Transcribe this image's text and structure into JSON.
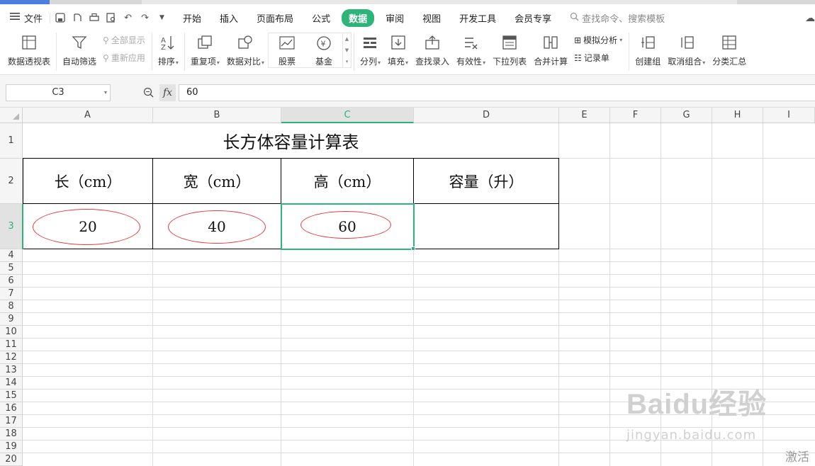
{
  "colors": {
    "accent": "#2eb37a",
    "oval": "#e53b3b",
    "tab_strip": [
      "#4a7fe0",
      "#e8e8e8"
    ]
  },
  "menubar": {
    "file_label": "文件",
    "tabs": [
      "开始",
      "插入",
      "页面布局",
      "公式",
      "数据",
      "审阅",
      "视图",
      "开发工具",
      "会员专享"
    ],
    "active_tab": "数据",
    "search_placeholder": "查找命令、搜索模板"
  },
  "ribbon": {
    "pivot": "数据透视表",
    "autofilter": "自动筛选",
    "show_all": "全部显示",
    "reapply": "重新应用",
    "sort": "排序",
    "duplicates": "重复项",
    "compare": "数据对比",
    "stock": "股票",
    "fund": "基金",
    "split": "分列",
    "fill": "填充",
    "lookup": "查找录入",
    "validity": "有效性",
    "dropdown": "下拉列表",
    "consolidate": "合并计算",
    "simulate": "模拟分析",
    "record": "记录单",
    "group": "创建组",
    "ungroup": "取消组合",
    "subtotal": "分类汇总"
  },
  "formula_bar": {
    "cell_ref": "C3",
    "fx": "fx",
    "value": "60"
  },
  "columns": [
    "A",
    "B",
    "C",
    "D",
    "E",
    "F",
    "G",
    "H",
    "I"
  ],
  "selected_column": "C",
  "rows": [
    "1",
    "2",
    "3",
    "4",
    "5",
    "6",
    "7",
    "8",
    "9",
    "10",
    "11",
    "12",
    "13",
    "14",
    "15",
    "16",
    "17",
    "18",
    "19",
    "20"
  ],
  "selected_row": "3",
  "sheet": {
    "title": "长方体容量计算表",
    "headers": [
      "长（cm）",
      "宽（cm）",
      "高（cm）",
      "容量（升）"
    ],
    "values": [
      "20",
      "40",
      "60",
      ""
    ]
  },
  "watermark": {
    "brand": "Baidu经验",
    "url": "jingyan.baidu.com"
  },
  "activate_text": "激活"
}
